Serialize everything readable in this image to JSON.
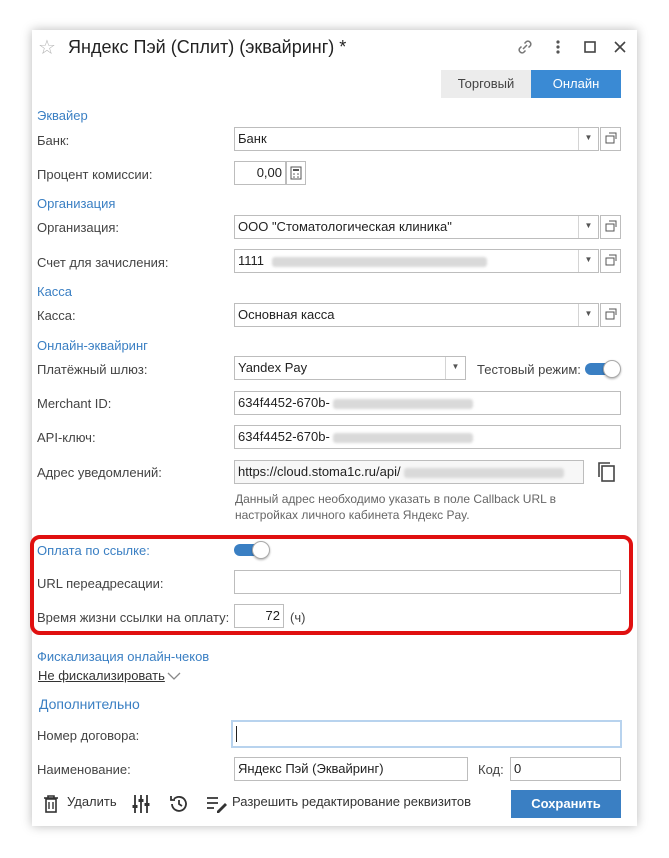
{
  "window": {
    "title": "Яндекс Пэй (Сплит) (эквайринг) *"
  },
  "tabs": [
    {
      "label": "Торговый",
      "active": false
    },
    {
      "label": "Онлайн",
      "active": true
    }
  ],
  "acquirer": {
    "section": "Эквайер",
    "bank_label": "Банк:",
    "bank_value": "Банк",
    "commission_label": "Процент комиссии:",
    "commission_value": "0,00"
  },
  "organization": {
    "section": "Организация",
    "org_label": "Организация:",
    "org_value": "ООО \"Стоматологическая клиника\"",
    "account_label": "Счет для зачисления:",
    "account_value_prefix": "1111"
  },
  "cash": {
    "section": "Касса",
    "cash_label": "Касса:",
    "cash_value": "Основная касса"
  },
  "online": {
    "section": "Онлайн-эквайринг",
    "gateway_label": "Платёжный шлюз:",
    "gateway_value": "Yandex Pay",
    "test_mode_label": "Тестовый режим:",
    "merchant_label": "Merchant ID:",
    "merchant_value_prefix": "634f4452-670b-",
    "api_label": "API-ключ:",
    "api_value_prefix": "634f4452-670b-",
    "notify_label": "Адрес уведомлений:",
    "notify_value_prefix": "https://cloud.stoma1c.ru/api/",
    "notify_hint_1": "Данный адрес необходимо указать в поле Callback URL в",
    "notify_hint_2": "настройках личного кабинета Яндекс Pay."
  },
  "payment_link": {
    "label": "Оплата по ссылке:",
    "redirect_label": "URL переадресации:",
    "redirect_value": "",
    "lifetime_label": "Время жизни ссылки на оплату:",
    "lifetime_value": "72",
    "lifetime_unit": "(ч)"
  },
  "fiscal": {
    "section": "Фискализация онлайн-чеков",
    "link": "Не фискализировать"
  },
  "extra": {
    "section": "Дополнительно",
    "contract_label": "Номер договора:",
    "contract_value": "",
    "name_label": "Наименование:",
    "name_value": "Яндекс Пэй (Эквайринг)",
    "code_label": "Код:",
    "code_value": "0"
  },
  "toolbar": {
    "delete_label": "Удалить",
    "allow_edit_label": "Разрешить редактирование реквизитов",
    "save_label": "Сохранить"
  },
  "colors": {
    "accent": "#3a7fc3",
    "highlight": "#e01010"
  }
}
